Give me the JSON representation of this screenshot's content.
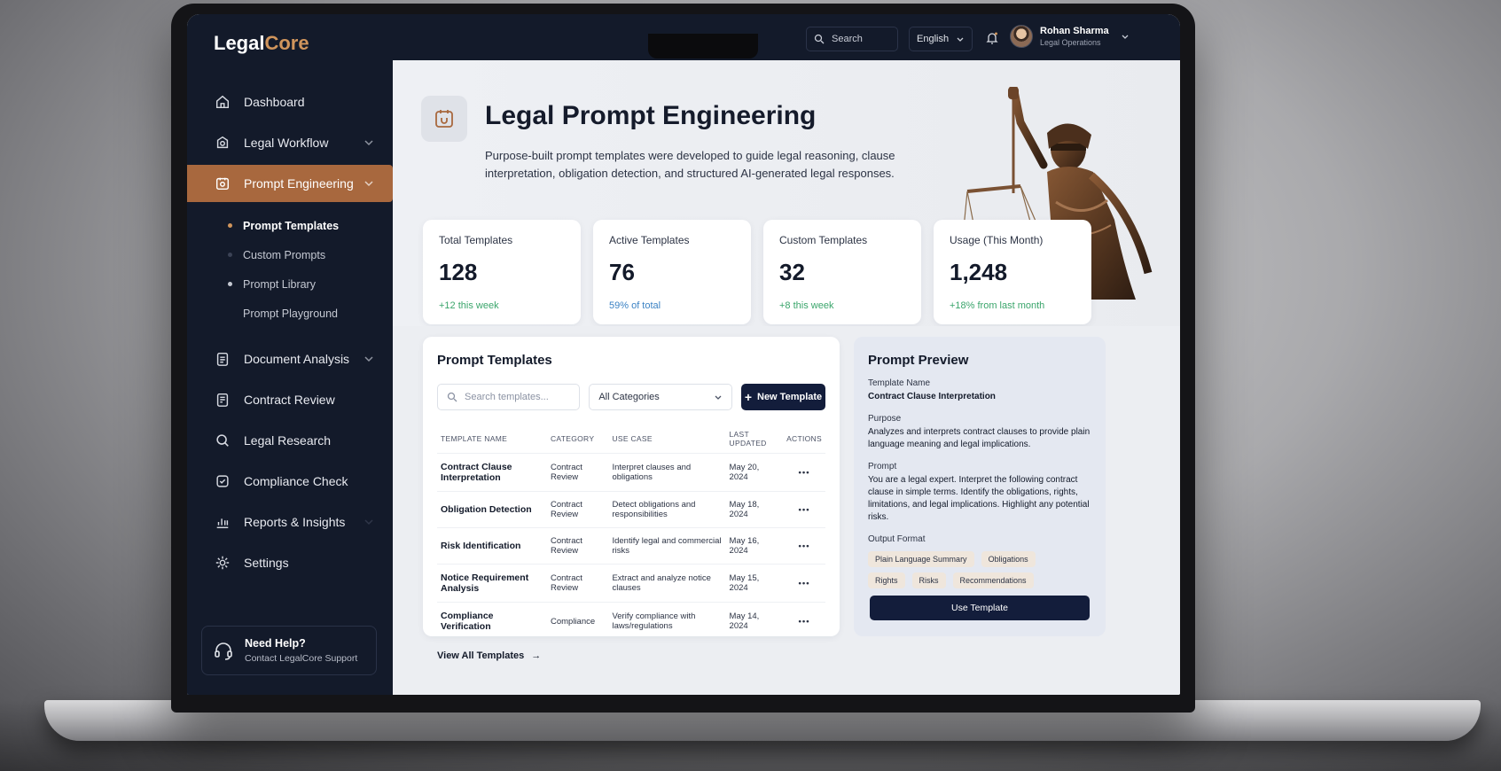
{
  "app": {
    "brand_main": "Legal",
    "brand_accent": "Core",
    "accent_color": "#a8683e"
  },
  "sidebar": {
    "items": [
      {
        "label": "Dashboard",
        "icon": "home-icon"
      },
      {
        "label": "Legal Workflow",
        "icon": "workflow-icon"
      },
      {
        "label": "Prompt Engineering",
        "icon": "prompt-icon",
        "active": true
      },
      {
        "label": "Document Analysis",
        "icon": "document-icon"
      },
      {
        "label": "Contract Review",
        "icon": "contract-icon"
      },
      {
        "label": "Legal Research",
        "icon": "search-icon"
      },
      {
        "label": "Compliance Check",
        "icon": "shield-check-icon"
      },
      {
        "label": "Reports & Insights",
        "icon": "chart-icon"
      },
      {
        "label": "Settings",
        "icon": "gear-icon"
      }
    ],
    "subitems": [
      {
        "label": "Prompt Templates",
        "active": true
      },
      {
        "label": "Custom Prompts"
      },
      {
        "label": "Prompt Library"
      },
      {
        "label": "Prompt Playground"
      }
    ],
    "help": {
      "title": "Need Help?",
      "subtitle": "Contact LegalCore Support"
    }
  },
  "topbar": {
    "search_placeholder": "Search",
    "language": "English",
    "user_name": "Rohan Sharma",
    "user_role": "Legal Operations"
  },
  "hero": {
    "title": "Legal Prompt Engineering",
    "description": "Purpose-built prompt templates were developed to guide legal reasoning, clause interpretation, obligation detection, and structured AI-generated legal responses."
  },
  "stats": [
    {
      "label": "Total Templates",
      "value": "128",
      "delta": "+12 this week"
    },
    {
      "label": "Active Templates",
      "value": "76",
      "delta": "59% of total"
    },
    {
      "label": "Custom Templates",
      "value": "32",
      "delta": "+8 this week"
    },
    {
      "label": "Usage (This Month)",
      "value": "1,248",
      "delta": "+18% from last month"
    }
  ],
  "templates": {
    "title": "Prompt Templates",
    "search_placeholder": "Search templates...",
    "category_select": "All Categories",
    "new_button": "New Template",
    "columns": [
      "TEMPLATE NAME",
      "CATEGORY",
      "USE CASE",
      "LAST UPDATED",
      "ACTIONS"
    ],
    "rows": [
      {
        "name": "Contract Clause Interpretation",
        "category": "Contract Review",
        "use_case": "Interpret clauses and obligations",
        "updated": "May 20, 2024"
      },
      {
        "name": "Obligation Detection",
        "category": "Contract Review",
        "use_case": "Detect obligations and responsibilities",
        "updated": "May 18, 2024"
      },
      {
        "name": "Risk Identification",
        "category": "Contract Review",
        "use_case": "Identify legal and commercial risks",
        "updated": "May 16, 2024"
      },
      {
        "name": "Notice Requirement Analysis",
        "category": "Contract Review",
        "use_case": "Extract and analyze notice clauses",
        "updated": "May 15, 2024"
      },
      {
        "name": "Compliance Verification",
        "category": "Compliance",
        "use_case": "Verify compliance with laws/regulations",
        "updated": "May 14, 2024"
      }
    ],
    "actions_glyph": "•••",
    "view_all": "View All Templates"
  },
  "preview": {
    "title": "Prompt Preview",
    "name_label": "Template Name",
    "name_value": "Contract Clause Interpretation",
    "purpose_label": "Purpose",
    "purpose_value": "Analyzes and interprets contract clauses to provide plain language meaning and legal implications.",
    "prompt_label": "Prompt",
    "prompt_value": "You are a legal expert. Interpret the following contract clause in simple terms. Identify the obligations, rights, limitations, and legal implications. Highlight any potential risks.",
    "format_label": "Output Format",
    "formats": [
      "Plain Language Summary",
      "Obligations",
      "Rights",
      "Risks",
      "Recommendations"
    ],
    "button": "Use Template"
  }
}
